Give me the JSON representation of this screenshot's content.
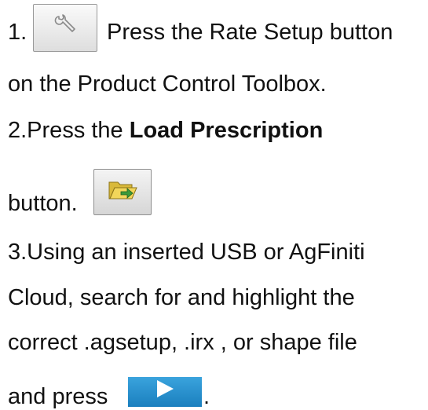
{
  "steps": {
    "s1_num": "1.",
    "s1_a": "Press the Rate Setup button",
    "s1_b": "on the Product Control Toolbox.",
    "s2_a": "2.Press the ",
    "s2_bold": "Load Prescription",
    "s2_b": "button.",
    "s3_a": "3.Using an inserted USB or AgFiniti",
    "s3_b": "Cloud, search for and highlight the",
    "s3_c": "correct .agsetup, .irx , or shape file",
    "s3_d": "and press",
    "s3_end": "."
  },
  "icons": {
    "rate_setup": "wrench-icon",
    "load_prescription": "folder-arrow-icon",
    "next": "play-arrow-icon"
  },
  "colors": {
    "next_button": "#2a8fcf"
  }
}
